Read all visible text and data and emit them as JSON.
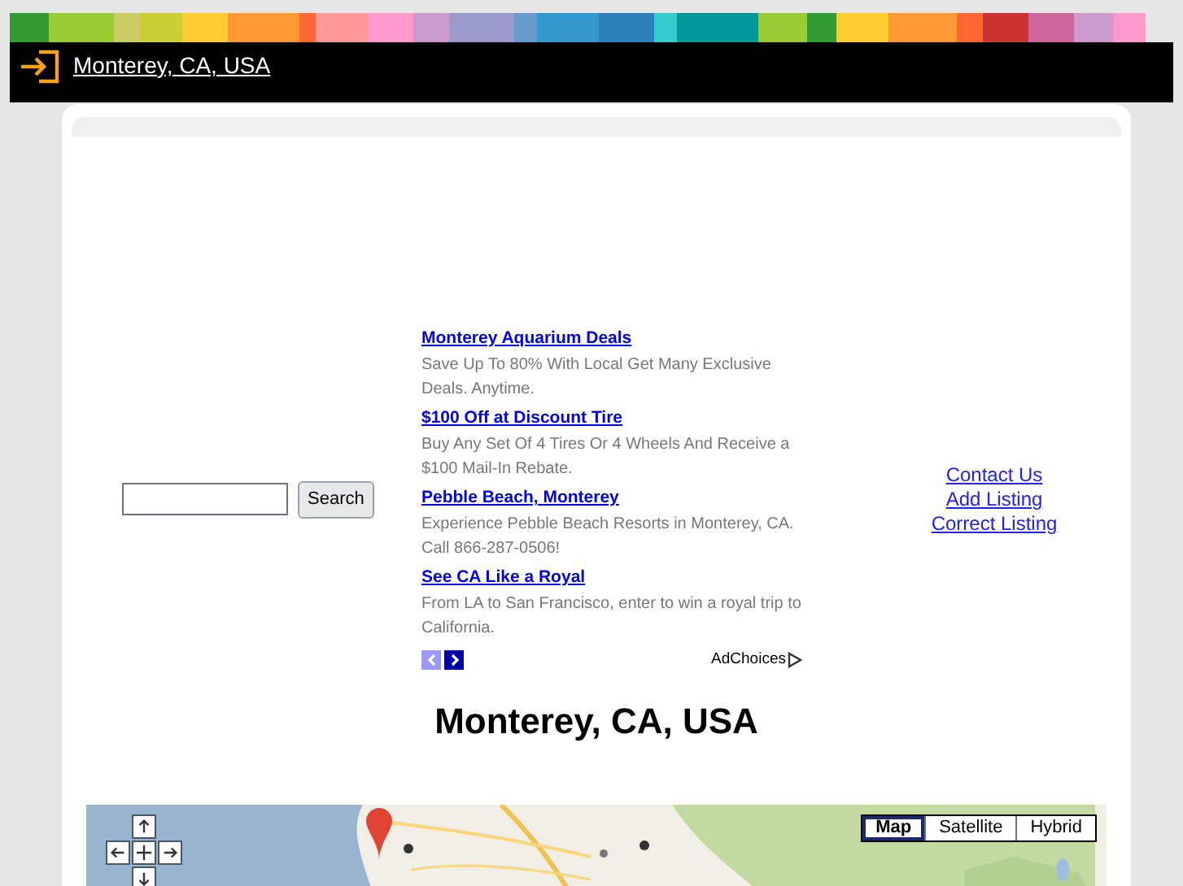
{
  "header": {
    "title": "Monterey, CA, USA"
  },
  "search": {
    "button": "Search"
  },
  "ads": [
    {
      "title": "Monterey Aquarium Deals",
      "text": "Save Up To 80% With Local Get Many Exclusive Deals. Anytime."
    },
    {
      "title": "$100 Off at Discount Tire",
      "text": "Buy Any Set Of 4 Tires Or 4 Wheels And Receive a $100 Mail-In Rebate."
    },
    {
      "title": "Pebble Beach, Monterey",
      "text": "Experience Pebble Beach Resorts in Monterey, CA. Call 866-287-0506!"
    },
    {
      "title": "See CA Like a Royal",
      "text": "From LA to San Francisco, enter to win a royal trip to California."
    }
  ],
  "ad_choices": "AdChoices",
  "links": [
    "Contact Us",
    "Add Listing",
    "Correct Listing"
  ],
  "page_title": "Monterey, CA, USA",
  "map": {
    "map_types": [
      {
        "label": "Map",
        "selected": true
      },
      {
        "label": "Satellite",
        "selected": false
      },
      {
        "label": "Hybrid",
        "selected": false
      }
    ]
  }
}
